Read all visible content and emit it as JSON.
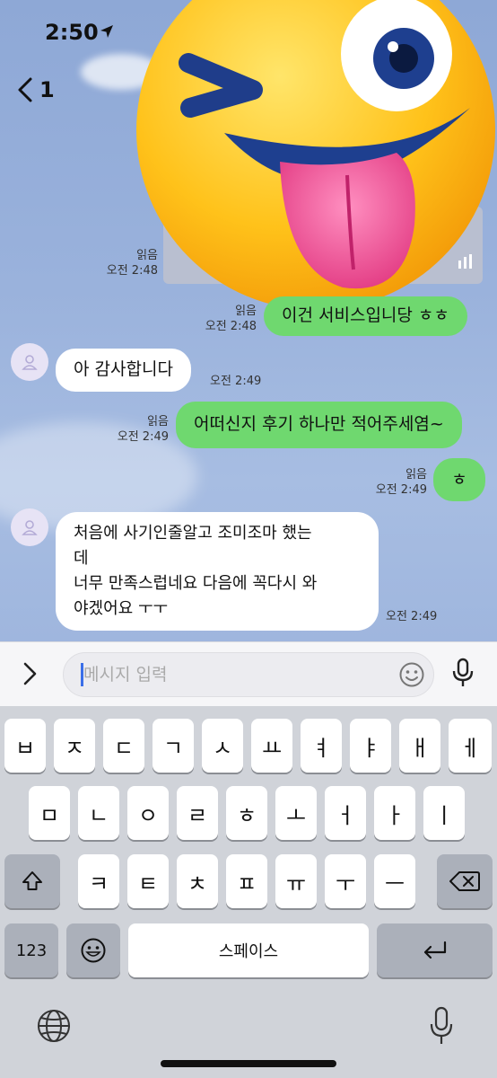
{
  "status_bar": {
    "time": "2:50"
  },
  "header": {
    "back_count": "1"
  },
  "messages": [
    {
      "from": "me",
      "read": "읽음",
      "time": "오전 2:48",
      "text": ""
    },
    {
      "from": "me",
      "read": "읽음",
      "time": "오전 2:48",
      "text": "이건 서비스입니당 ㅎㅎ"
    },
    {
      "from": "them",
      "time": "오전 2:49",
      "text": "아 감사합니다"
    },
    {
      "from": "me",
      "read": "읽음",
      "time": "오전 2:49",
      "text": "어떠신지 후기 하나만 적어주세염~"
    },
    {
      "from": "me",
      "read": "읽음",
      "time": "오전 2:49",
      "text": "ㅎ"
    },
    {
      "from": "them",
      "time": "오전 2:49",
      "lines": [
        "처음에 사기인줄알고 조미조마 했는",
        "데",
        "너무 만족스럽네요 다음에 꼭다시 와",
        "야겠어요 ㅜㅜ"
      ]
    }
  ],
  "input": {
    "placeholder": "메시지 입력"
  },
  "keyboard": {
    "row1": [
      "ㅂ",
      "ㅈ",
      "ㄷ",
      "ㄱ",
      "ㅅ",
      "ㅛ",
      "ㅕ",
      "ㅑ",
      "ㅐ",
      "ㅔ"
    ],
    "row2": [
      "ㅁ",
      "ㄴ",
      "ㅇ",
      "ㄹ",
      "ㅎ",
      "ㅗ",
      "ㅓ",
      "ㅏ",
      "ㅣ"
    ],
    "row3": [
      "ㅋ",
      "ㅌ",
      "ㅊ",
      "ㅍ",
      "ㅠ",
      "ㅜ",
      "ㅡ"
    ],
    "numbers_label": "123",
    "space_label": "스페이스"
  },
  "colors": {
    "chat_bg": "#8fa9d6",
    "my_bubble": "#6fd86f",
    "their_bubble": "#ffffff",
    "keyboard_bg": "#d0d3d9"
  },
  "icons": [
    "location-arrow-icon",
    "back-chevron-icon",
    "winking-tongue-emoji",
    "profile-avatar-icon",
    "chevron-right-icon",
    "smiley-icon",
    "microphone-icon",
    "shift-icon",
    "delete-icon",
    "emoji-key-icon",
    "return-icon",
    "globe-icon"
  ]
}
